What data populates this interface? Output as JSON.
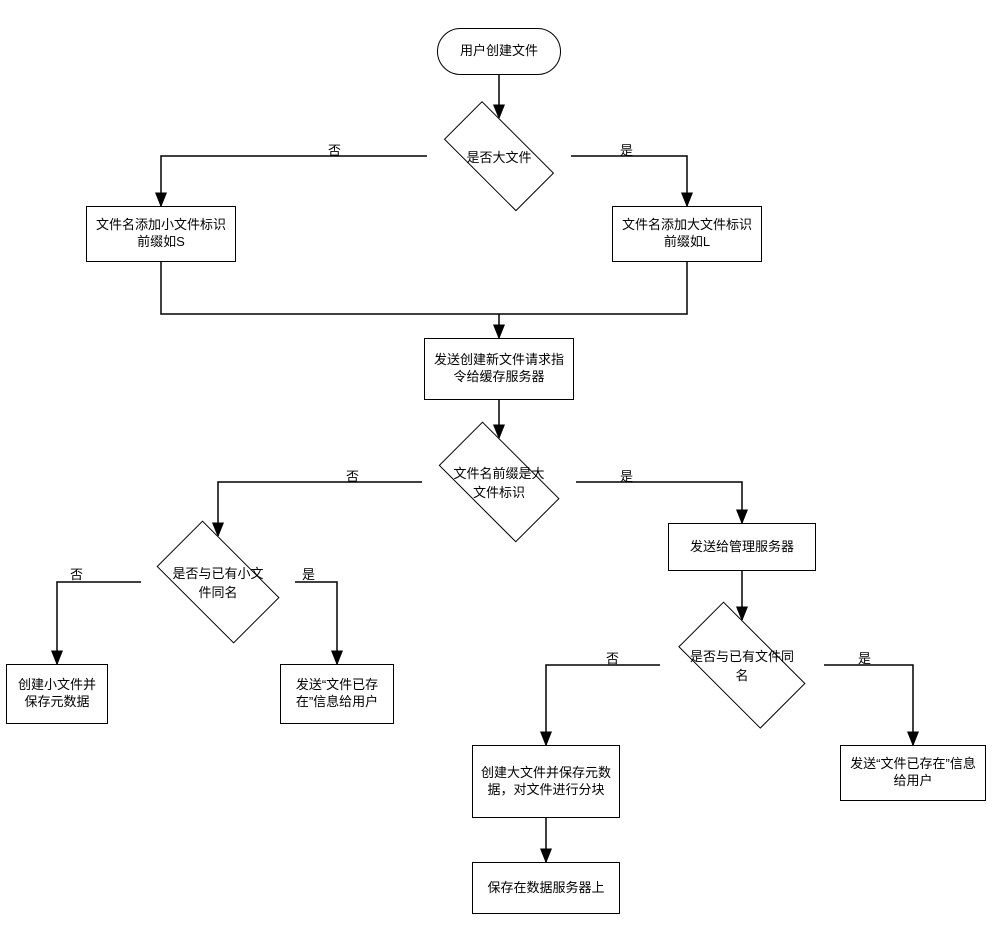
{
  "chart_data": {
    "type": "flowchart",
    "title": "",
    "nodes": [
      {
        "id": "n1",
        "shape": "terminator",
        "text": "用户创建文件"
      },
      {
        "id": "n2",
        "shape": "decision",
        "text": "是否大文件"
      },
      {
        "id": "n3",
        "shape": "process",
        "text": "文件名添加小文件标识前缀如S"
      },
      {
        "id": "n4",
        "shape": "process",
        "text": "文件名添加大文件标识前缀如L"
      },
      {
        "id": "n5",
        "shape": "process",
        "text": "发送创建新文件请求指令给缓存服务器"
      },
      {
        "id": "n6",
        "shape": "decision",
        "text": "文件名前缀是大文件标识"
      },
      {
        "id": "n7",
        "shape": "decision",
        "text": "是否与已有小文件同名"
      },
      {
        "id": "n8",
        "shape": "process",
        "text": "发送给管理服务器"
      },
      {
        "id": "n9",
        "shape": "process",
        "text": "创建小文件并保存元数据"
      },
      {
        "id": "n10",
        "shape": "process",
        "text": "发送\"文件已存在\"信息给用户"
      },
      {
        "id": "n11",
        "shape": "decision",
        "text": "是否与已有文件同名"
      },
      {
        "id": "n12",
        "shape": "process",
        "text": "创建大文件并保存元数据，对文件进行分块"
      },
      {
        "id": "n13",
        "shape": "process",
        "text": "发送\"文件已存在\"信息给用户"
      },
      {
        "id": "n14",
        "shape": "process",
        "text": "保存在数据服务器上"
      }
    ],
    "edges": [
      {
        "from": "n1",
        "to": "n2",
        "label": ""
      },
      {
        "from": "n2",
        "to": "n3",
        "label": "否"
      },
      {
        "from": "n2",
        "to": "n4",
        "label": "是"
      },
      {
        "from": "n3",
        "to": "n5",
        "label": ""
      },
      {
        "from": "n4",
        "to": "n5",
        "label": ""
      },
      {
        "from": "n5",
        "to": "n6",
        "label": ""
      },
      {
        "from": "n6",
        "to": "n7",
        "label": "否"
      },
      {
        "from": "n6",
        "to": "n8",
        "label": "是"
      },
      {
        "from": "n7",
        "to": "n9",
        "label": "否"
      },
      {
        "from": "n7",
        "to": "n10",
        "label": "是"
      },
      {
        "from": "n8",
        "to": "n11",
        "label": ""
      },
      {
        "from": "n11",
        "to": "n12",
        "label": "否"
      },
      {
        "from": "n11",
        "to": "n13",
        "label": "是"
      },
      {
        "from": "n12",
        "to": "n14",
        "label": ""
      }
    ]
  },
  "nodes": {
    "n1": "用户创建文件",
    "n2": "是否大文件",
    "n3": "文件名添加小文件标识前缀如S",
    "n4": "文件名添加大文件标识前缀如L",
    "n5": "发送创建新文件请求指令给缓存服务器",
    "n6": "文件名前缀是大文件标识",
    "n7": "是否与已有小文件同名",
    "n8": "发送给管理服务器",
    "n9": "创建小文件并保存元数据",
    "n10": "发送“文件已存在”信息给用户",
    "n11": "是否与已有文件同名",
    "n12": "创建大文件并保存元数据，对文件进行分块",
    "n13": "发送“文件已存在”信息给用户",
    "n14": "保存在数据服务器上"
  },
  "labels": {
    "yes": "是",
    "no": "否"
  }
}
